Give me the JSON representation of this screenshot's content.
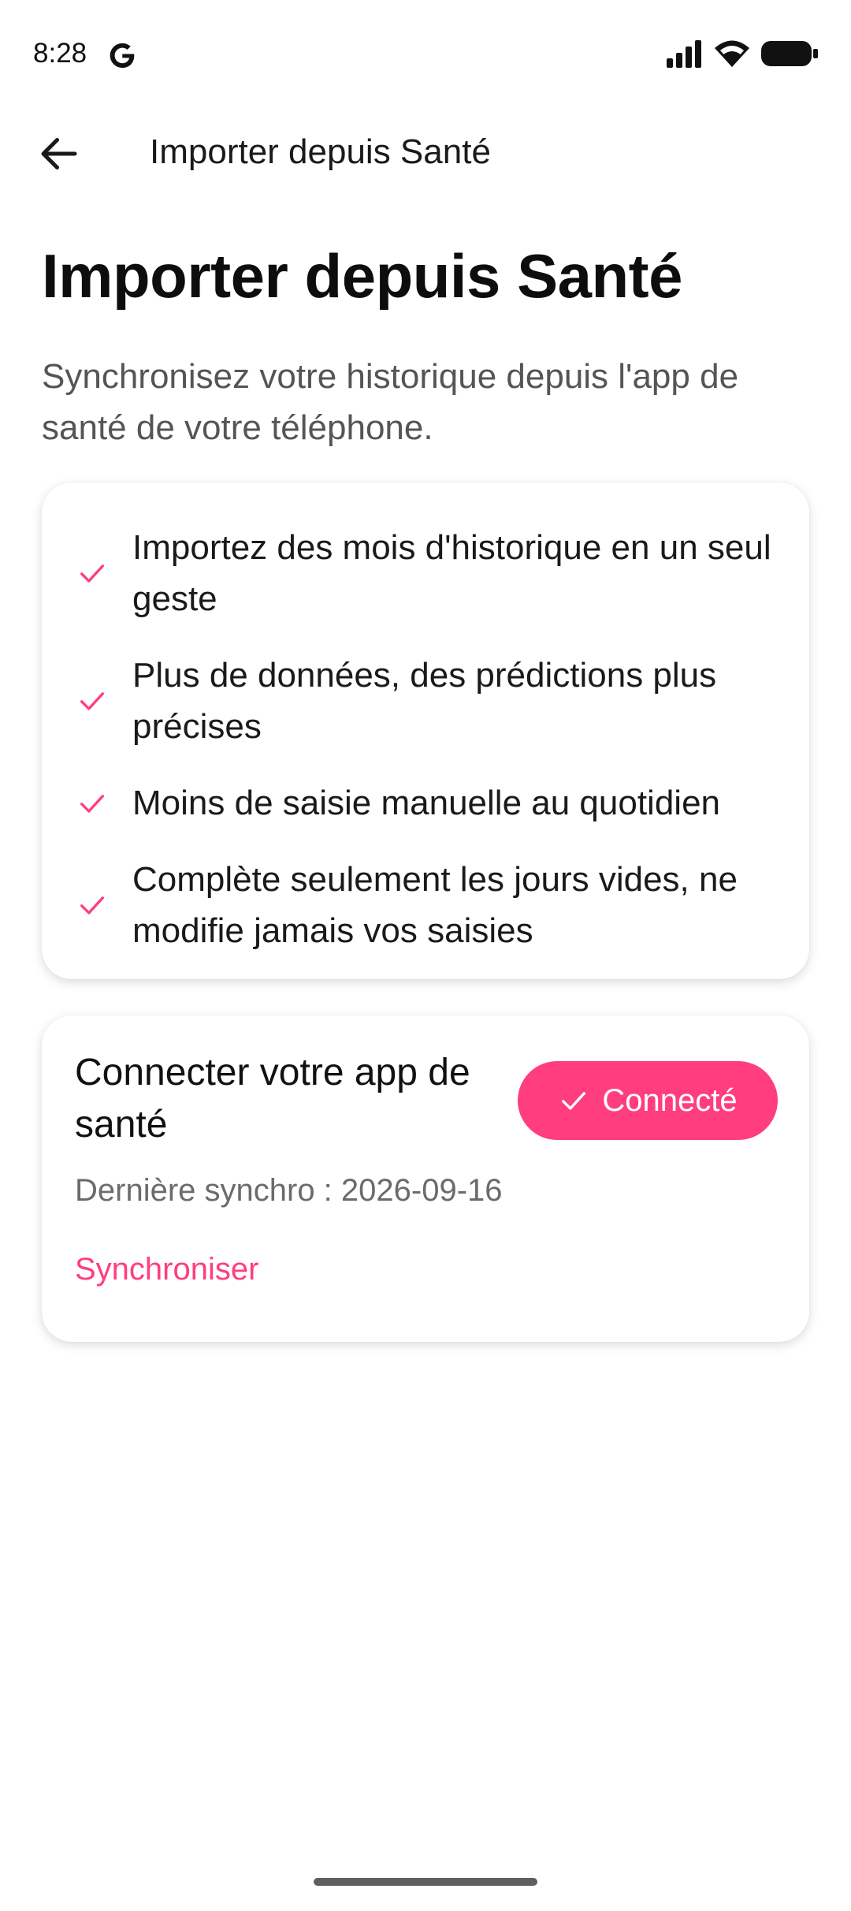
{
  "status_bar": {
    "time": "8:28"
  },
  "top_bar": {
    "title": "Importer depuis Santé"
  },
  "header": {
    "title": "Importer depuis Santé",
    "subtitle": "Synchronisez votre historique depuis l'app de santé de votre téléphone."
  },
  "features": [
    "Importez des mois d'historique en un seul geste",
    "Plus de données, des prédictions plus précises",
    "Moins de saisie manuelle au quotidien",
    "Complète seulement les jours vides, ne modifie jamais vos saisies"
  ],
  "connect_card": {
    "title": "Connecter votre app de santé",
    "button_label": "Connecté",
    "last_sync": "Dernière synchro : 2026-09-16",
    "sync_link": "Synchroniser"
  },
  "colors": {
    "accent": "#ff3d7f",
    "text": "#111111",
    "muted": "#6b6b6b"
  },
  "icons": [
    "google-g-icon",
    "signal-icon",
    "wifi-icon",
    "battery-icon",
    "back-arrow-icon",
    "check-icon"
  ]
}
